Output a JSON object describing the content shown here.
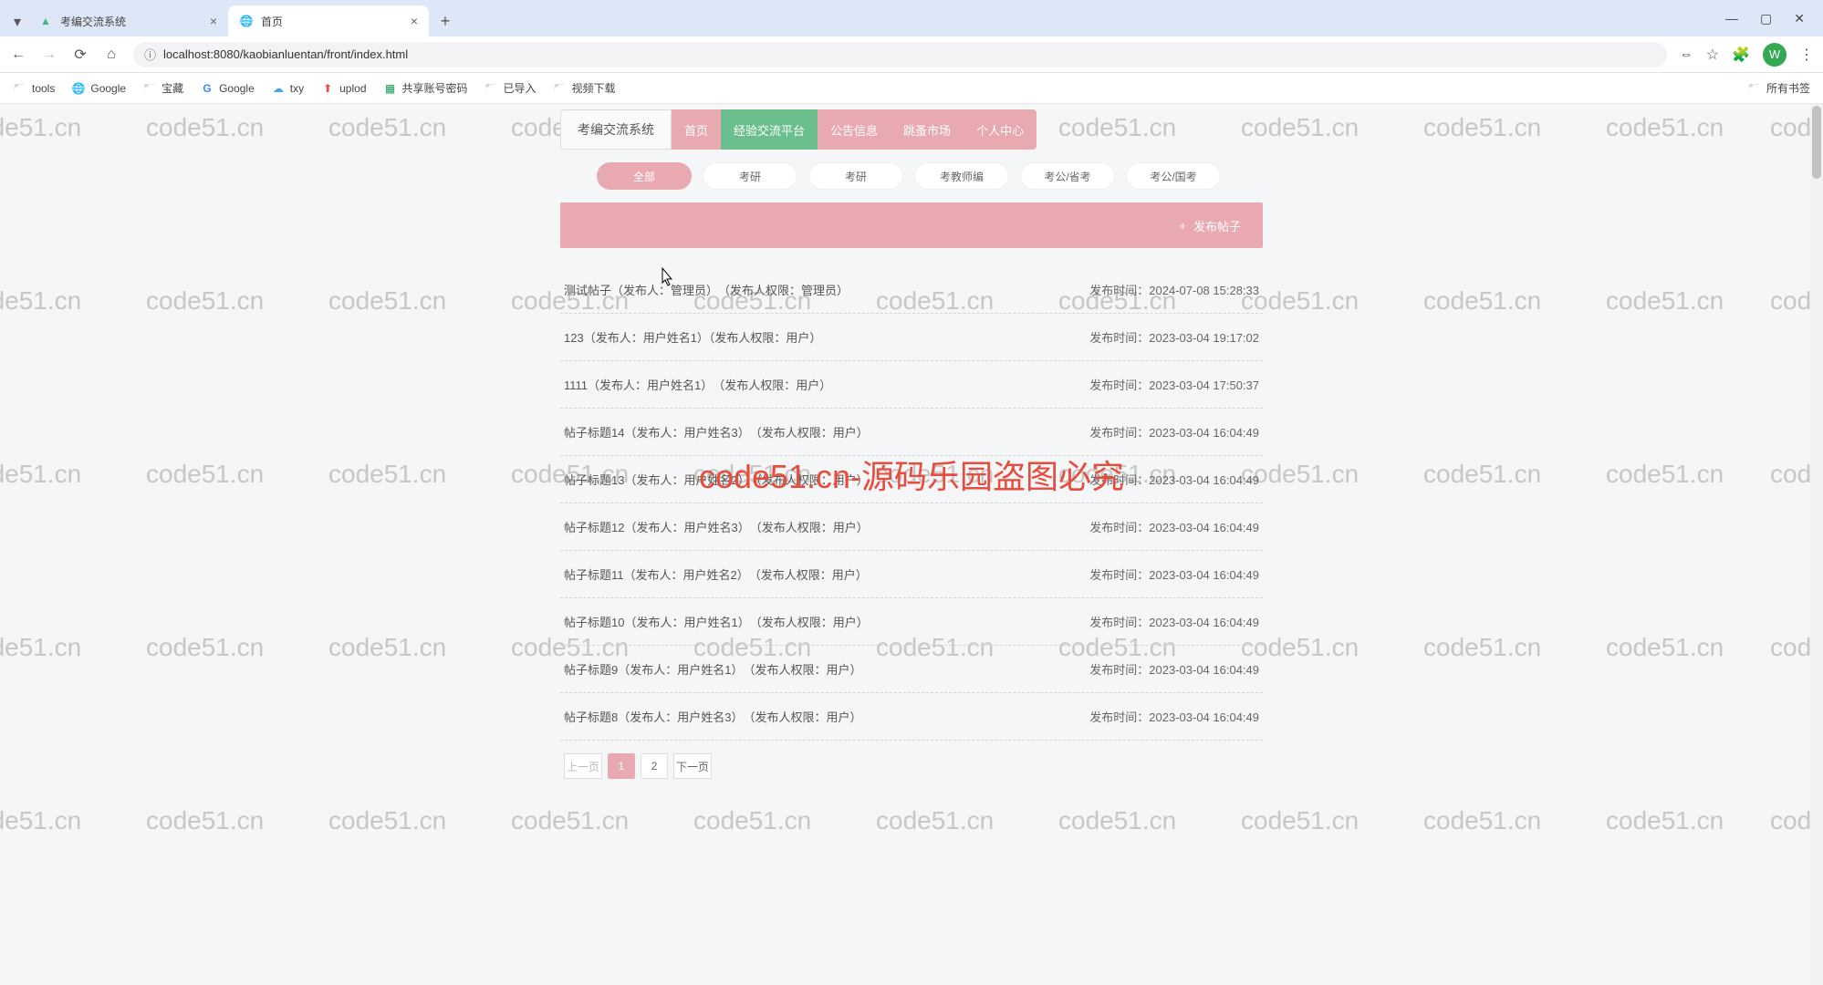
{
  "browser": {
    "tabs": [
      {
        "title": "考编交流系统",
        "active": false,
        "icon": "vue"
      },
      {
        "title": "首页",
        "active": true,
        "icon": "globe"
      }
    ],
    "url": "localhost:8080/kaobianluentan/front/index.html",
    "avatar_letter": "W"
  },
  "bookmarks": [
    {
      "label": "tools",
      "type": "folder"
    },
    {
      "label": "Google",
      "type": "site"
    },
    {
      "label": "宝藏",
      "type": "folder"
    },
    {
      "label": "Google",
      "type": "g"
    },
    {
      "label": "txy",
      "type": "cloud"
    },
    {
      "label": "uplod",
      "type": "upload"
    },
    {
      "label": "共享账号密码",
      "type": "sheet"
    },
    {
      "label": "已导入",
      "type": "folder"
    },
    {
      "label": "视频下载",
      "type": "folder"
    }
  ],
  "bookmarks_right": "所有书签",
  "watermark_text": "code51.cn",
  "center_watermark": "code51.cn-源码乐园盗图必究",
  "nav": {
    "brand": "考编交流系统",
    "items": [
      {
        "label": "首页",
        "active": false
      },
      {
        "label": "经验交流平台",
        "active": true
      },
      {
        "label": "公告信息",
        "active": false
      },
      {
        "label": "跳蚤市场",
        "active": false
      },
      {
        "label": "个人中心",
        "active": false
      }
    ]
  },
  "filters": [
    {
      "label": "全部",
      "active": true
    },
    {
      "label": "考研",
      "active": false
    },
    {
      "label": "考研",
      "active": false
    },
    {
      "label": "考教师编",
      "active": false
    },
    {
      "label": "考公/省考",
      "active": false
    },
    {
      "label": "考公/国考",
      "active": false
    }
  ],
  "publish_label": "发布帖子",
  "time_label": "发布时间：",
  "posts": [
    {
      "title": "测试帖子（发布人：管理员）　（发布人权限：管理员）",
      "time": "2024-07-08 15:28:33"
    },
    {
      "title": "123（发布人：用户姓名1）（发布人权限：用户）",
      "time": "2023-03-04 19:17:02"
    },
    {
      "title": "1111（发布人：用户姓名1）　（发布人权限：用户）",
      "time": "2023-03-04 17:50:37"
    },
    {
      "title": "帖子标题14（发布人：用户姓名3）　（发布人权限：用户）",
      "time": "2023-03-04 16:04:49"
    },
    {
      "title": "帖子标题13（发布人：用户姓名2）　（发布人权限：用户）",
      "time": "2023-03-04 16:04:49"
    },
    {
      "title": "帖子标题12（发布人：用户姓名3）　（发布人权限：用户）",
      "time": "2023-03-04 16:04:49"
    },
    {
      "title": "帖子标题11（发布人：用户姓名2）　（发布人权限：用户）",
      "time": "2023-03-04 16:04:49"
    },
    {
      "title": "帖子标题10（发布人：用户姓名1）　（发布人权限：用户）",
      "time": "2023-03-04 16:04:49"
    },
    {
      "title": "帖子标题9（发布人：用户姓名1）　（发布人权限：用户）",
      "time": "2023-03-04 16:04:49"
    },
    {
      "title": "帖子标题8（发布人：用户姓名3）　（发布人权限：用户）",
      "time": "2023-03-04 16:04:49"
    }
  ],
  "pagination": {
    "prev": "上一页",
    "next": "下一页",
    "pages": [
      "1",
      "2"
    ],
    "current": "1"
  }
}
